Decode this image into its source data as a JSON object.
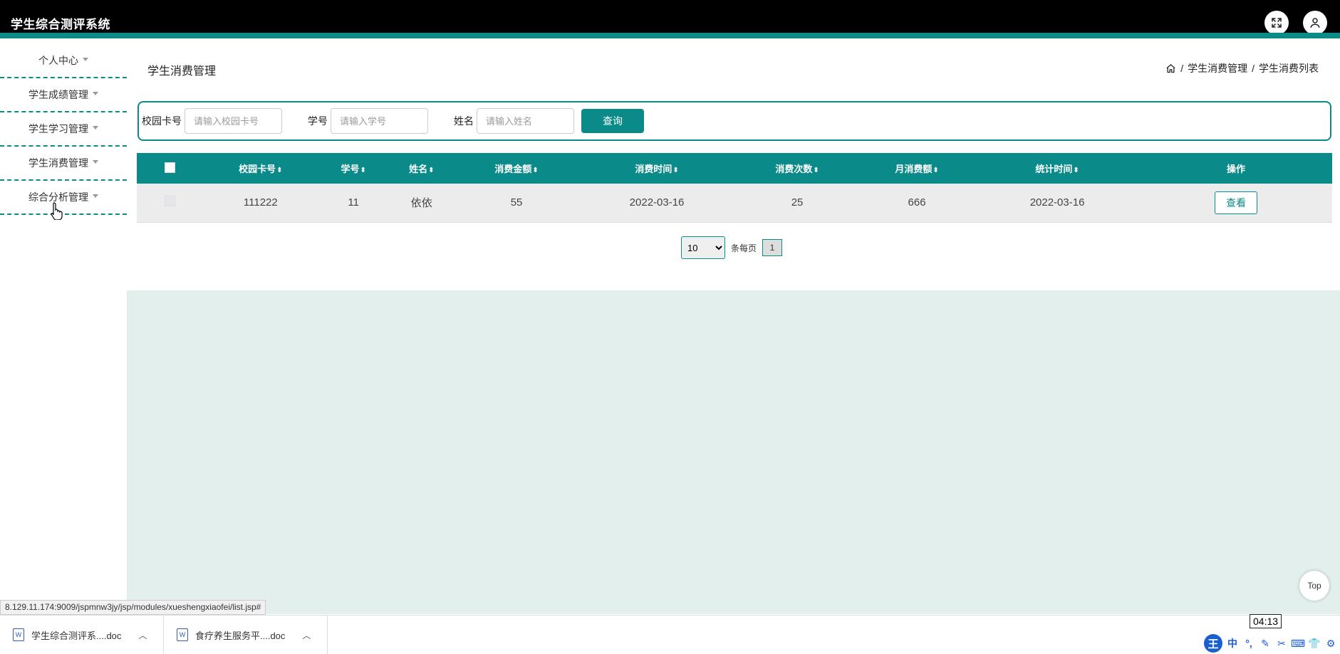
{
  "app": {
    "title": "学生综合测评系统"
  },
  "sidebar": {
    "items": [
      {
        "label": "个人中心"
      },
      {
        "label": "学生成绩管理"
      },
      {
        "label": "学生学习管理"
      },
      {
        "label": "学生消费管理"
      },
      {
        "label": "综合分析管理"
      }
    ]
  },
  "page": {
    "title": "学生消费管理",
    "breadcrumb": [
      "学生消费管理",
      "学生消费列表"
    ],
    "breadcrumb_sep": "/"
  },
  "search": {
    "card_label": "校园卡号",
    "card_placeholder": "请输入校园卡号",
    "id_label": "学号",
    "id_placeholder": "请输入学号",
    "name_label": "姓名",
    "name_placeholder": "请输入姓名",
    "button": "查询"
  },
  "table": {
    "columns": [
      "校园卡号",
      "学号",
      "姓名",
      "消费金额",
      "消费时间",
      "消费次数",
      "月消费额",
      "统计时间",
      "操作"
    ],
    "sort_icon": "⬍",
    "rows": [
      {
        "card": "111222",
        "id": "11",
        "name": "依依",
        "amount": "55",
        "time": "2022-03-16",
        "count": "25",
        "monthly": "666",
        "stat_time": "2022-03-16",
        "action": "查看"
      }
    ]
  },
  "pager": {
    "page_size": "10",
    "page_size_options": [
      "10"
    ],
    "per_page_label": "条每页",
    "current_page": "1"
  },
  "top_button": "Top",
  "status_url": "8.129.11.174:9009/jspmnw3jy/jsp/modules/xueshengxiaofei/list.jsp#",
  "downloads": [
    {
      "name": "学生综合测评系....doc"
    },
    {
      "name": "食疗养生服务平....doc"
    }
  ],
  "clock": "04:13",
  "tray": {
    "ime_badge": "王",
    "ime_mode": "中"
  },
  "colors": {
    "accent": "#0a8a88",
    "topbar": "#000000",
    "content_bg": "#e2efec"
  }
}
